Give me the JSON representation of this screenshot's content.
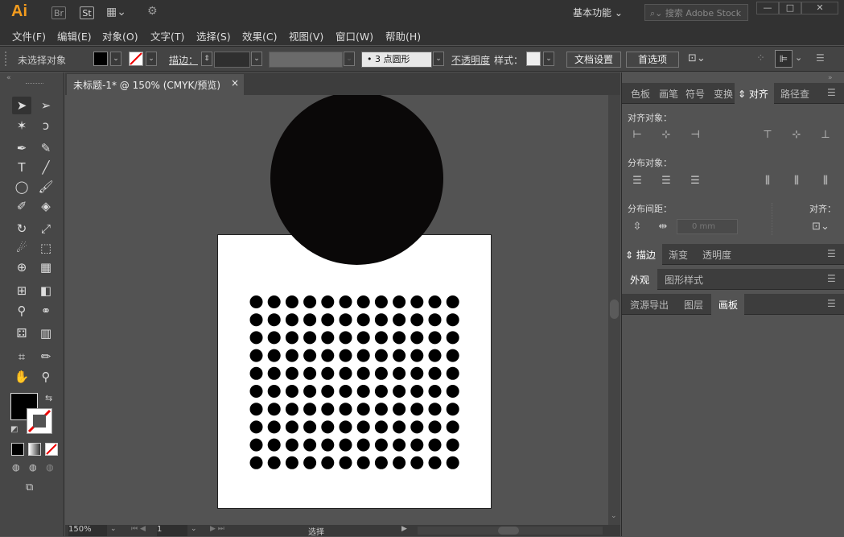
{
  "app": {
    "logo": "Ai",
    "bridge": "Br",
    "stock": "St",
    "workspace": "基本功能",
    "search_placeholder": "搜索 Adobe Stock"
  },
  "window_controls": {
    "minimize": "—",
    "maximize": "□",
    "close": "✕"
  },
  "menu": [
    "文件(F)",
    "编辑(E)",
    "对象(O)",
    "文字(T)",
    "选择(S)",
    "效果(C)",
    "视图(V)",
    "窗口(W)",
    "帮助(H)"
  ],
  "control_bar": {
    "selection_state": "未选择对象",
    "stroke_label": "描边：",
    "brush_value": "3 点圆形",
    "opacity_label": "不透明度",
    "style_label": "样式：",
    "doc_setup": "文档设置",
    "preferences": "首选项"
  },
  "document": {
    "tab_title": "未标题-1* @ 150% (CMYK/预览)",
    "close": "×",
    "zoom": "150%",
    "artboard_number": "1",
    "status": "选择"
  },
  "artwork": {
    "dot_rows": 10,
    "dot_cols": 12,
    "circle_color": "#0a0808"
  },
  "panels": {
    "group1_tabs": [
      "色板",
      "画笔",
      "符号",
      "变换",
      "对齐",
      "路径查"
    ],
    "align": {
      "align_objects": "对齐对象：",
      "distribute_objects": "分布对象：",
      "distribute_spacing": "分布间距：",
      "align_to": "对齐：",
      "spacing_value": "0 mm"
    },
    "group2_tabs": [
      "描边",
      "渐变",
      "透明度"
    ],
    "group3_tabs": [
      "外观",
      "图形样式"
    ],
    "group4_tabs": [
      "资源导出",
      "图层",
      "画板"
    ]
  },
  "colors": {
    "accent": "#f39c1e",
    "fill": "#000000"
  }
}
